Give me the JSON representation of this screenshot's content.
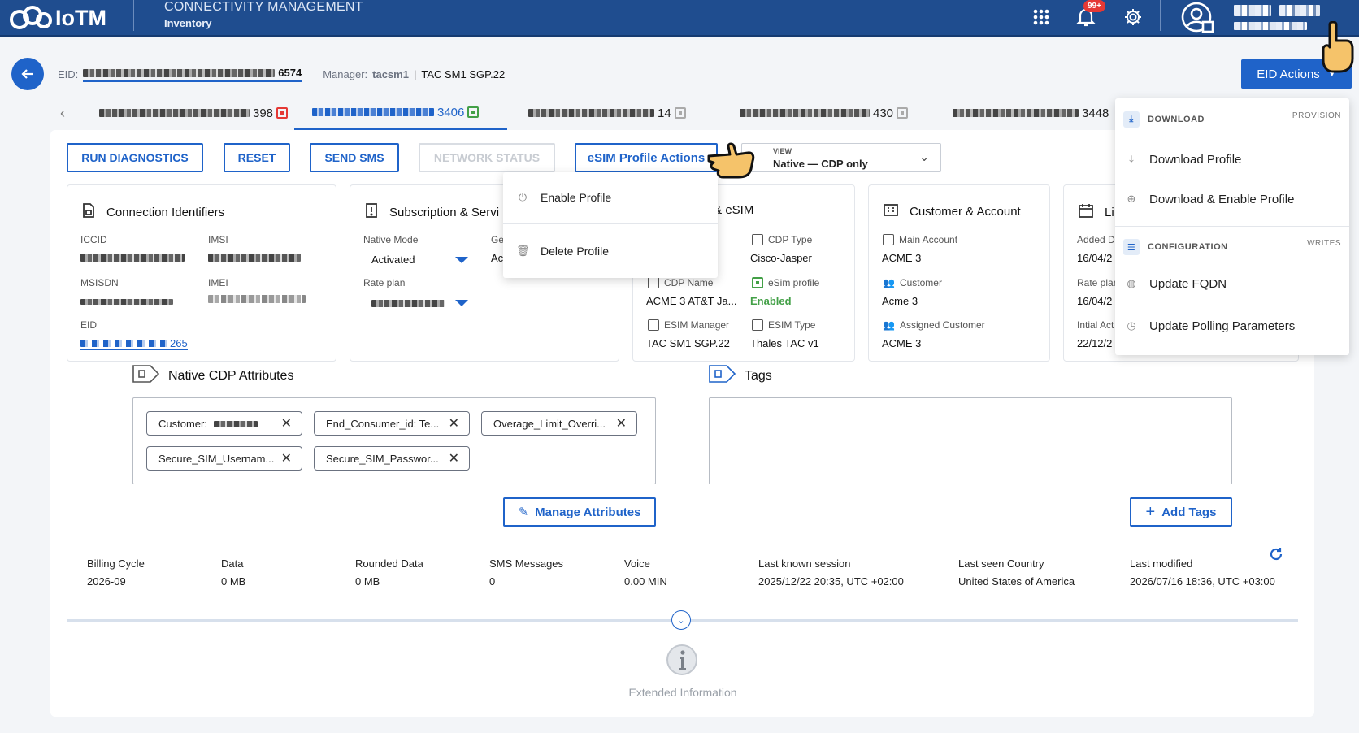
{
  "topbar": {
    "brand": "IoTM",
    "app_title": "CONNECTIVITY MANAGEMENT",
    "app_subtitle": "Inventory",
    "notification_count": "99+"
  },
  "header": {
    "eid_label": "EID:",
    "eid_suffix": "6574",
    "manager_label": "Manager:",
    "manager_value": "tacsm1",
    "separator": "|",
    "manager_name": "TAC SM1 SGP.22",
    "eid_actions_label": "EID Actions"
  },
  "tabs": [
    {
      "suffix": "398",
      "status": "red"
    },
    {
      "suffix": "3406",
      "status": "green"
    },
    {
      "suffix": "14",
      "status": "gray"
    },
    {
      "suffix": "430",
      "status": "gray"
    },
    {
      "suffix": "3448",
      "status": "gray"
    }
  ],
  "actions": {
    "run_diagnostics": "RUN DIAGNOSTICS",
    "reset": "RESET",
    "send_sms": "SEND SMS",
    "network_status": "NETWORK STATUS",
    "esim_profile_actions": "eSIM Profile Actions",
    "view_label": "VIEW",
    "view_value": "Native — CDP only"
  },
  "esim_menu": {
    "enable_profile": "Enable Profile",
    "delete_profile": "Delete Profile"
  },
  "eid_menu": {
    "download_header": "DOWNLOAD",
    "download_tag": "PROVISION",
    "download_profile": "Download Profile",
    "download_enable_profile": "Download & Enable Profile",
    "config_header": "CONFIGURATION",
    "config_tag": "WRITES",
    "update_fqdn": "Update FQDN",
    "update_polling": "Update Polling Parameters"
  },
  "cards": {
    "connection": {
      "title": "Connection Identifiers",
      "iccid_label": "ICCID",
      "imsi_label": "IMSI",
      "msisdn_label": "MSISDN",
      "imei_label": "IMEI",
      "eid_label": "EID",
      "eid_suffix": "265"
    },
    "subscription": {
      "title": "Subscription & Servi",
      "native_mode_label": "Native Mode",
      "native_mode_value": "Activated",
      "col2_label": "Ge",
      "col2_value": "Ac",
      "rate_plan_label": "Rate plan"
    },
    "esim": {
      "title": "r & eSIM",
      "cdp_type_label": "CDP Type",
      "cdp_type_value": "Cisco-Jasper",
      "cdp_name_label": "CDP Name",
      "cdp_name_value": "ACME 3 AT&T Ja...",
      "esim_profile_label": "eSim profile",
      "esim_profile_value": "Enabled",
      "esim_manager_label": "ESIM Manager",
      "esim_manager_value": "TAC SM1 SGP.22",
      "esim_type_label": "ESIM Type",
      "esim_type_value": "Thales TAC v1"
    },
    "customer": {
      "title": "Customer & Account",
      "main_account_label": "Main Account",
      "main_account_value": "ACME 3",
      "customer_label": "Customer",
      "customer_value": "Acme 3",
      "assigned_label": "Assigned Customer",
      "assigned_value": "ACME 3"
    },
    "lifecycle": {
      "title": "Li",
      "added_label": "Added D",
      "added_value": "16/04/2",
      "rate_plan_label": "Rate plan",
      "rate_plan_value": "16/04/2",
      "initial_label": "Intial Act",
      "initial_value": "22/12/2"
    }
  },
  "attributes": {
    "title": "Native CDP Attributes",
    "chips": [
      "Customer:",
      "End_Consumer_id: Te...",
      "Overage_Limit_Overri...",
      "Secure_SIM_Usernam...",
      "Secure_SIM_Passwor..."
    ],
    "manage_button": "Manage Attributes"
  },
  "tags": {
    "title": "Tags",
    "add_button": "Add Tags"
  },
  "stats": [
    {
      "label": "Billing Cycle",
      "value": "2026-09"
    },
    {
      "label": "Data",
      "value": "0 MB"
    },
    {
      "label": "Rounded Data",
      "value": "0 MB"
    },
    {
      "label": "SMS Messages",
      "value": "0"
    },
    {
      "label": "Voice",
      "value": "0.00 MIN"
    },
    {
      "label": "Last known session",
      "value": "2025/12/22 20:35, UTC +02:00"
    },
    {
      "label": "Last seen Country",
      "value": "United States of America"
    },
    {
      "label": "Last modified",
      "value": "2026/07/16 18:36, UTC +03:00"
    }
  ],
  "extended_info": "Extended Information",
  "colors": {
    "primary": "#1f63c9",
    "topbar": "#1f4d8f",
    "enabled": "#43a047",
    "badge": "#e53935"
  }
}
